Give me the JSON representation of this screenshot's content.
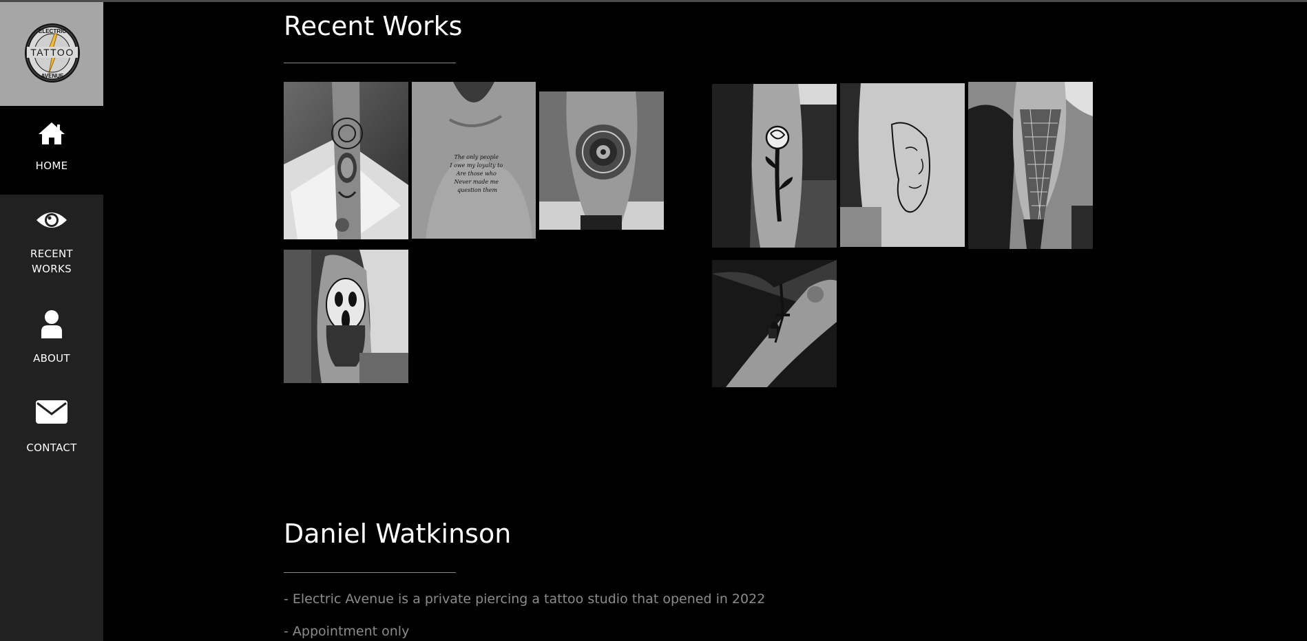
{
  "brand": {
    "logo_top": "ELECTRIC",
    "logo_mid": "TATTOO",
    "logo_bottom": "AVENUE",
    "accent": "#f2b73f"
  },
  "nav": {
    "items": [
      {
        "label": "HOME",
        "icon": "home-icon",
        "active": true
      },
      {
        "label_line1": "RECENT",
        "label_line2": "WORKS",
        "icon": "eye-icon"
      },
      {
        "label": "ABOUT",
        "icon": "user-icon"
      },
      {
        "label": "CONTACT",
        "icon": "envelope-icon"
      }
    ]
  },
  "recent_works": {
    "title": "Recent Works",
    "gallery": [
      {
        "subject": "buddha-mandala-forearm-tattoo"
      },
      {
        "subject": "chest-script-tattoo"
      },
      {
        "subject": "mandala-calf-tattoo"
      },
      {
        "subject": "ghostface-forearm-tattoo"
      },
      {
        "subject": "rose-forearm-tattoo"
      },
      {
        "subject": "line-face-arm-tattoo"
      },
      {
        "subject": "geometric-leg-tattoo"
      },
      {
        "subject": "dagger-arm-tattoo"
      }
    ],
    "chest_script": [
      "The only people",
      "I owe my loyalty to",
      "Are those who",
      "Never made me",
      "question them"
    ]
  },
  "about": {
    "title": "Daniel Watkinson",
    "lines": [
      "- Electric Avenue is a private piercing a tattoo studio that opened in 2022",
      "- Appointment only"
    ]
  }
}
